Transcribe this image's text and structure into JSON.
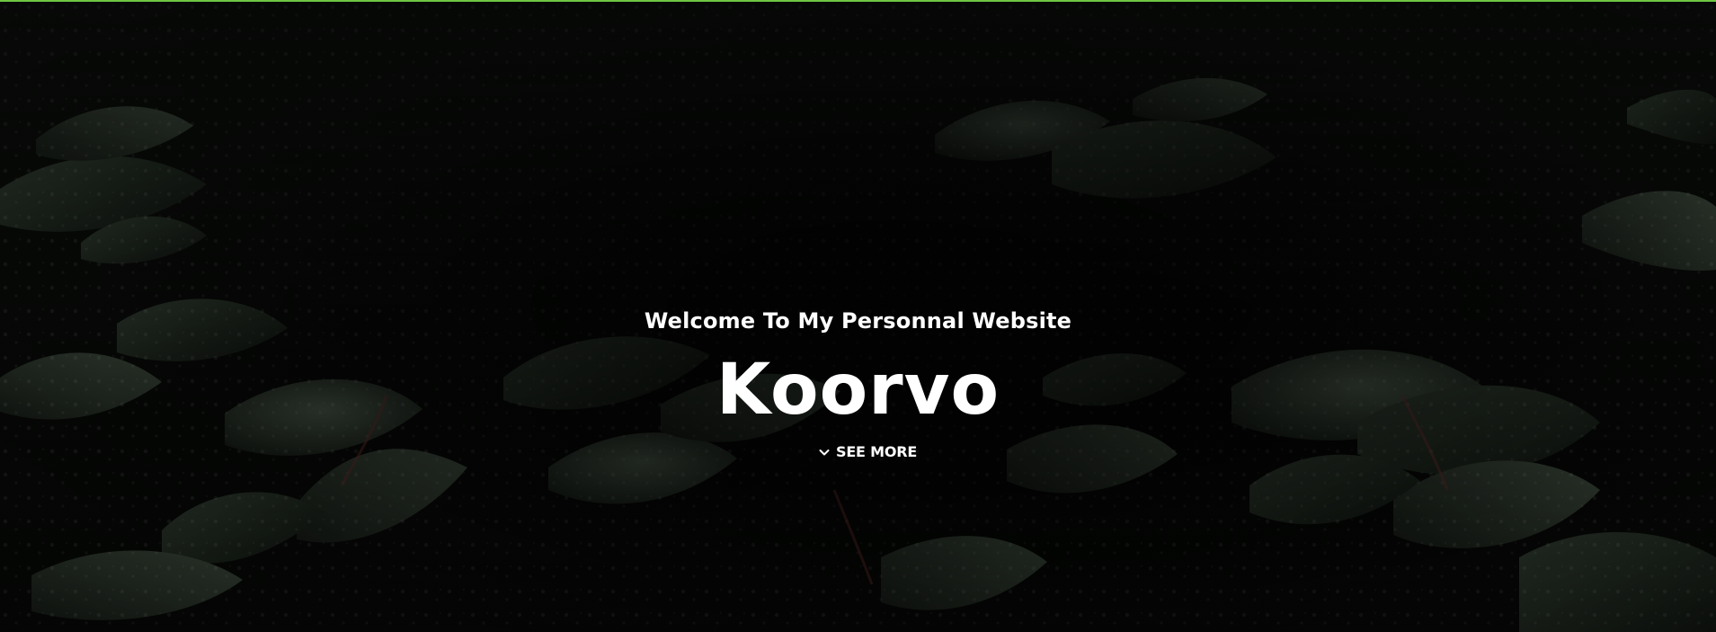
{
  "hero": {
    "subtitle": "Welcome To My Personnal Website",
    "title": "Koorvo",
    "cta_label": "SEE MORE",
    "cta_icon": "chevron-down-icon",
    "background_image": "dark green leaves with water droplets",
    "accent_color": "#7bdc4a",
    "text_color": "#ffffff"
  }
}
